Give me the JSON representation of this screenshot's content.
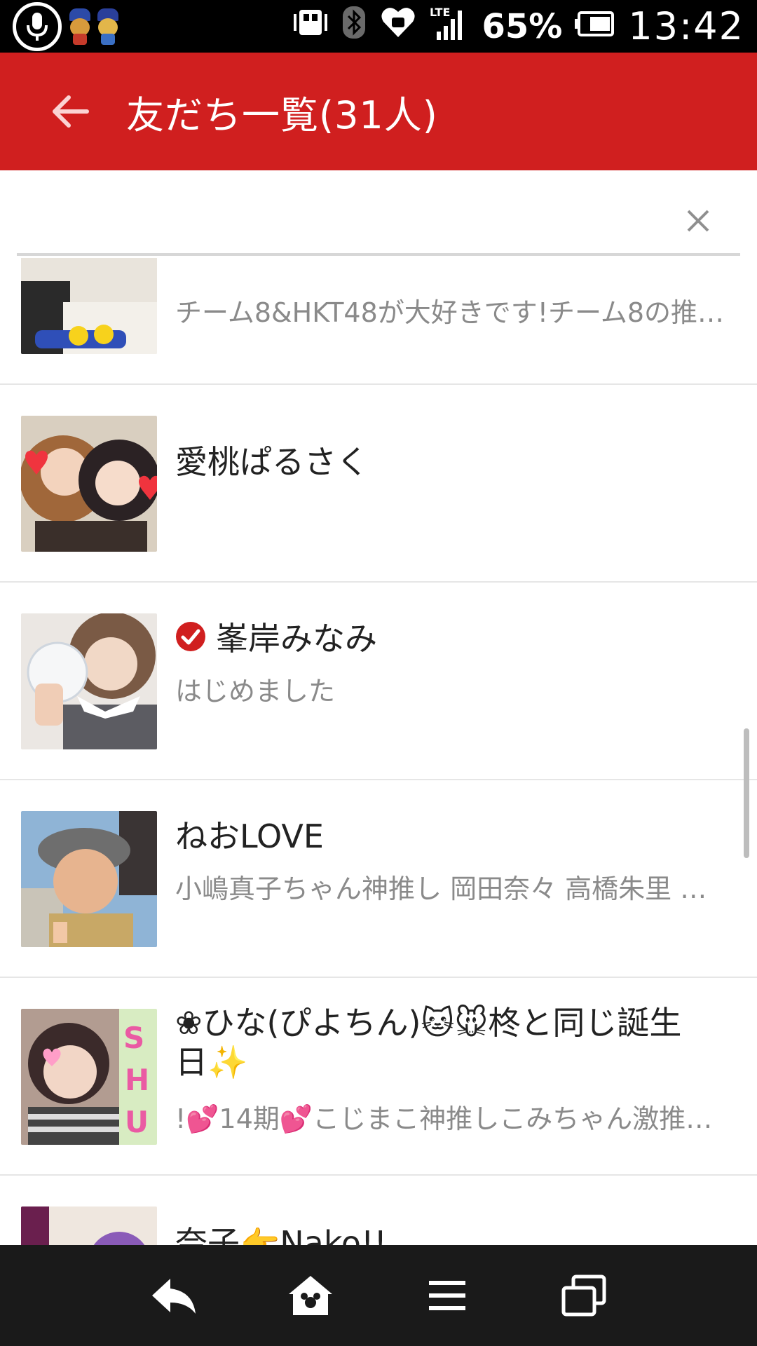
{
  "status_bar": {
    "battery_percent": "65%",
    "time": "13:42",
    "network": "LTE",
    "icons": [
      "mic-icon",
      "mascot-icon",
      "vibrate-icon",
      "bluetooth-icon",
      "heart-icon",
      "lte-signal-icon",
      "battery-icon"
    ]
  },
  "header": {
    "title": "友だち一覧(31人)",
    "back_icon": "arrow-left-icon",
    "color": "#d01f1f"
  },
  "search": {
    "value": "",
    "placeholder": "",
    "clear_icon": "close-icon"
  },
  "friends": [
    {
      "name": "",
      "description": "チーム8&HKT48が大好きです!チーム8の推…",
      "verified": false
    },
    {
      "name": "愛桃ぱるさく",
      "description": "",
      "verified": false
    },
    {
      "name": "峯岸みなみ",
      "description": "はじめました",
      "verified": true
    },
    {
      "name": "ねおLOVE",
      "description": "小嶋真子ちゃん神推し 岡田奈々 高橋朱里 …",
      "verified": false
    },
    {
      "name_line1": "❀ひな(ぴよちん)🐱🐭柊と同じ誕生",
      "name_line2": "日✨",
      "description": "!💕14期💕こじまこ神推しこみちゃん激推…",
      "verified": false
    },
    {
      "name": "奈子👉Nako!!",
      "description": "",
      "verified": false
    }
  ],
  "nav_bar": {
    "icons": [
      "back-arrow-icon",
      "home-icon",
      "menu-icon",
      "recent-apps-icon"
    ]
  },
  "colors": {
    "accent": "#d01f1f",
    "status_bar": "#000000",
    "nav_bar": "#1a1a1a",
    "verified": "#d01f1f"
  }
}
